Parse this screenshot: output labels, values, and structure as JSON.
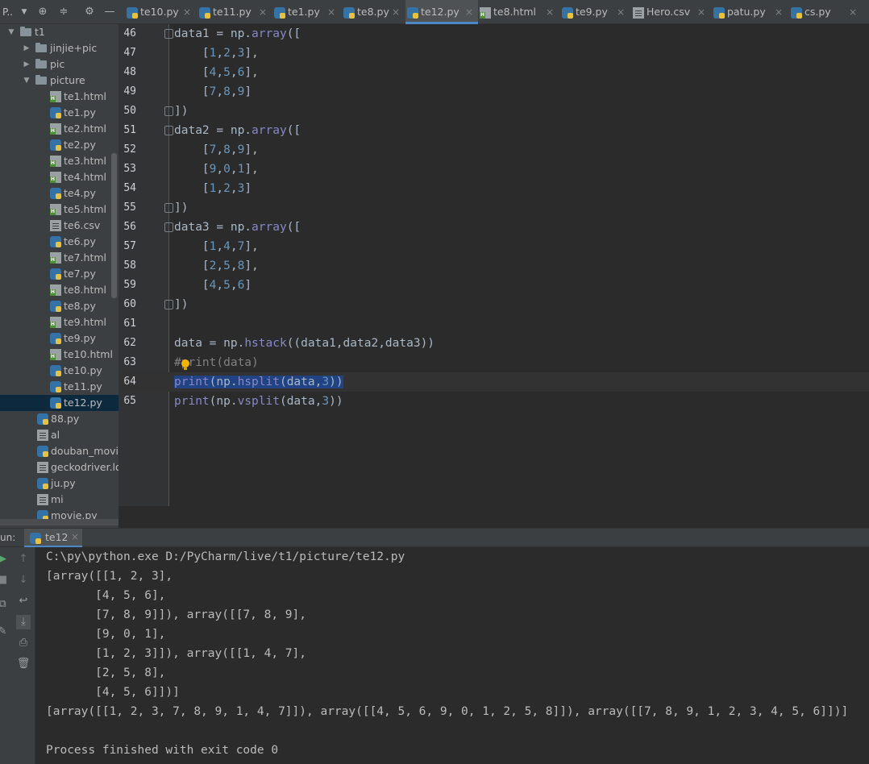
{
  "project_panel": {
    "title": "P..",
    "tree": [
      {
        "label": "t1",
        "type": "folder",
        "expanded": true,
        "depth": 0
      },
      {
        "label": "jinjie+pic",
        "type": "folder",
        "expanded": false,
        "depth": 1
      },
      {
        "label": "pic",
        "type": "folder",
        "expanded": false,
        "depth": 1
      },
      {
        "label": "picture",
        "type": "folder",
        "expanded": true,
        "depth": 1
      },
      {
        "label": "te1.html",
        "type": "html",
        "depth": 2
      },
      {
        "label": "te1.py",
        "type": "py",
        "depth": 2
      },
      {
        "label": "te2.html",
        "type": "html",
        "depth": 2
      },
      {
        "label": "te2.py",
        "type": "py",
        "depth": 2
      },
      {
        "label": "te3.html",
        "type": "html",
        "depth": 2
      },
      {
        "label": "te4.html",
        "type": "html",
        "depth": 2
      },
      {
        "label": "te4.py",
        "type": "py",
        "depth": 2
      },
      {
        "label": "te5.html",
        "type": "html",
        "depth": 2
      },
      {
        "label": "te6.csv",
        "type": "txt",
        "depth": 2
      },
      {
        "label": "te6.py",
        "type": "py",
        "depth": 2
      },
      {
        "label": "te7.html",
        "type": "html",
        "depth": 2
      },
      {
        "label": "te7.py",
        "type": "py",
        "depth": 2
      },
      {
        "label": "te8.html",
        "type": "html",
        "depth": 2
      },
      {
        "label": "te8.py",
        "type": "py",
        "depth": 2
      },
      {
        "label": "te9.html",
        "type": "html",
        "depth": 2
      },
      {
        "label": "te9.py",
        "type": "py",
        "depth": 2
      },
      {
        "label": "te10.html",
        "type": "html",
        "depth": 2
      },
      {
        "label": "te10.py",
        "type": "py",
        "depth": 2
      },
      {
        "label": "te11.py",
        "type": "py",
        "depth": 2
      },
      {
        "label": "te12.py",
        "type": "py",
        "depth": 2,
        "selected": true
      },
      {
        "label": "88.py",
        "type": "py",
        "depth": 1
      },
      {
        "label": "al",
        "type": "txt",
        "depth": 1
      },
      {
        "label": "douban_movie",
        "type": "py",
        "depth": 1
      },
      {
        "label": "geckodriver.log",
        "type": "txt",
        "depth": 1
      },
      {
        "label": "ju.py",
        "type": "py",
        "depth": 1
      },
      {
        "label": "mi",
        "type": "txt",
        "depth": 1
      },
      {
        "label": "movie.py",
        "type": "py",
        "depth": 1
      }
    ]
  },
  "tabs": [
    {
      "label": "te10.py",
      "type": "py"
    },
    {
      "label": "te11.py",
      "type": "py"
    },
    {
      "label": "te1.py",
      "type": "py"
    },
    {
      "label": "te8.py",
      "type": "py"
    },
    {
      "label": "te12.py",
      "type": "py",
      "active": true
    },
    {
      "label": "te8.html",
      "type": "html"
    },
    {
      "label": "te9.py",
      "type": "py"
    },
    {
      "label": "Hero.csv",
      "type": "txt"
    },
    {
      "label": "patu.py",
      "type": "py"
    },
    {
      "label": "cs.py",
      "type": "py"
    }
  ],
  "editor": {
    "lines": [
      {
        "num": "46",
        "text": "data1 = np.array(["
      },
      {
        "num": "47",
        "text": "    [1,2,3],"
      },
      {
        "num": "48",
        "text": "    [4,5,6],"
      },
      {
        "num": "49",
        "text": "    [7,8,9]"
      },
      {
        "num": "50",
        "text": "])"
      },
      {
        "num": "51",
        "text": "data2 = np.array(["
      },
      {
        "num": "52",
        "text": "    [7,8,9],"
      },
      {
        "num": "53",
        "text": "    [9,0,1],"
      },
      {
        "num": "54",
        "text": "    [1,2,3]"
      },
      {
        "num": "55",
        "text": "])"
      },
      {
        "num": "56",
        "text": "data3 = np.array(["
      },
      {
        "num": "57",
        "text": "    [1,4,7],"
      },
      {
        "num": "58",
        "text": "    [2,5,8],"
      },
      {
        "num": "59",
        "text": "    [4,5,6]"
      },
      {
        "num": "60",
        "text": "])"
      },
      {
        "num": "61",
        "text": ""
      },
      {
        "num": "62",
        "text": "data = np.hstack((data1,data2,data3))"
      },
      {
        "num": "63",
        "text": "#print(data)"
      },
      {
        "num": "64",
        "text": "print(np.hsplit(data,3))"
      },
      {
        "num": "65",
        "text": "print(np.vsplit(data,3))"
      }
    ],
    "current_line": "64"
  },
  "run": {
    "label": "un:",
    "tab_label": "te12",
    "console": [
      "C:\\py\\python.exe D:/PyCharm/live/t1/picture/te12.py",
      "[array([[1, 2, 3],",
      "       [4, 5, 6],",
      "       [7, 8, 9]]), array([[7, 8, 9],",
      "       [9, 0, 1],",
      "       [1, 2, 3]]), array([[1, 4, 7],",
      "       [2, 5, 8],",
      "       [4, 5, 6]])]",
      "[array([[1, 2, 3, 7, 8, 9, 1, 4, 7]]), array([[4, 5, 6, 9, 0, 1, 2, 5, 8]]), array([[7, 8, 9, 1, 2, 3, 4, 5, 6]])]",
      "",
      "Process finished with exit code 0"
    ]
  },
  "icons": {
    "dropdown": "chevron-down-icon",
    "locate": "crosshair-icon",
    "collapse": "collapse-all-icon",
    "settings": "gear-icon",
    "hide": "minimize-icon",
    "intention": "lightbulb-icon"
  },
  "colors": {
    "accent": "#4a88c7",
    "selection": "#214283",
    "bulb": "#f4b400"
  }
}
